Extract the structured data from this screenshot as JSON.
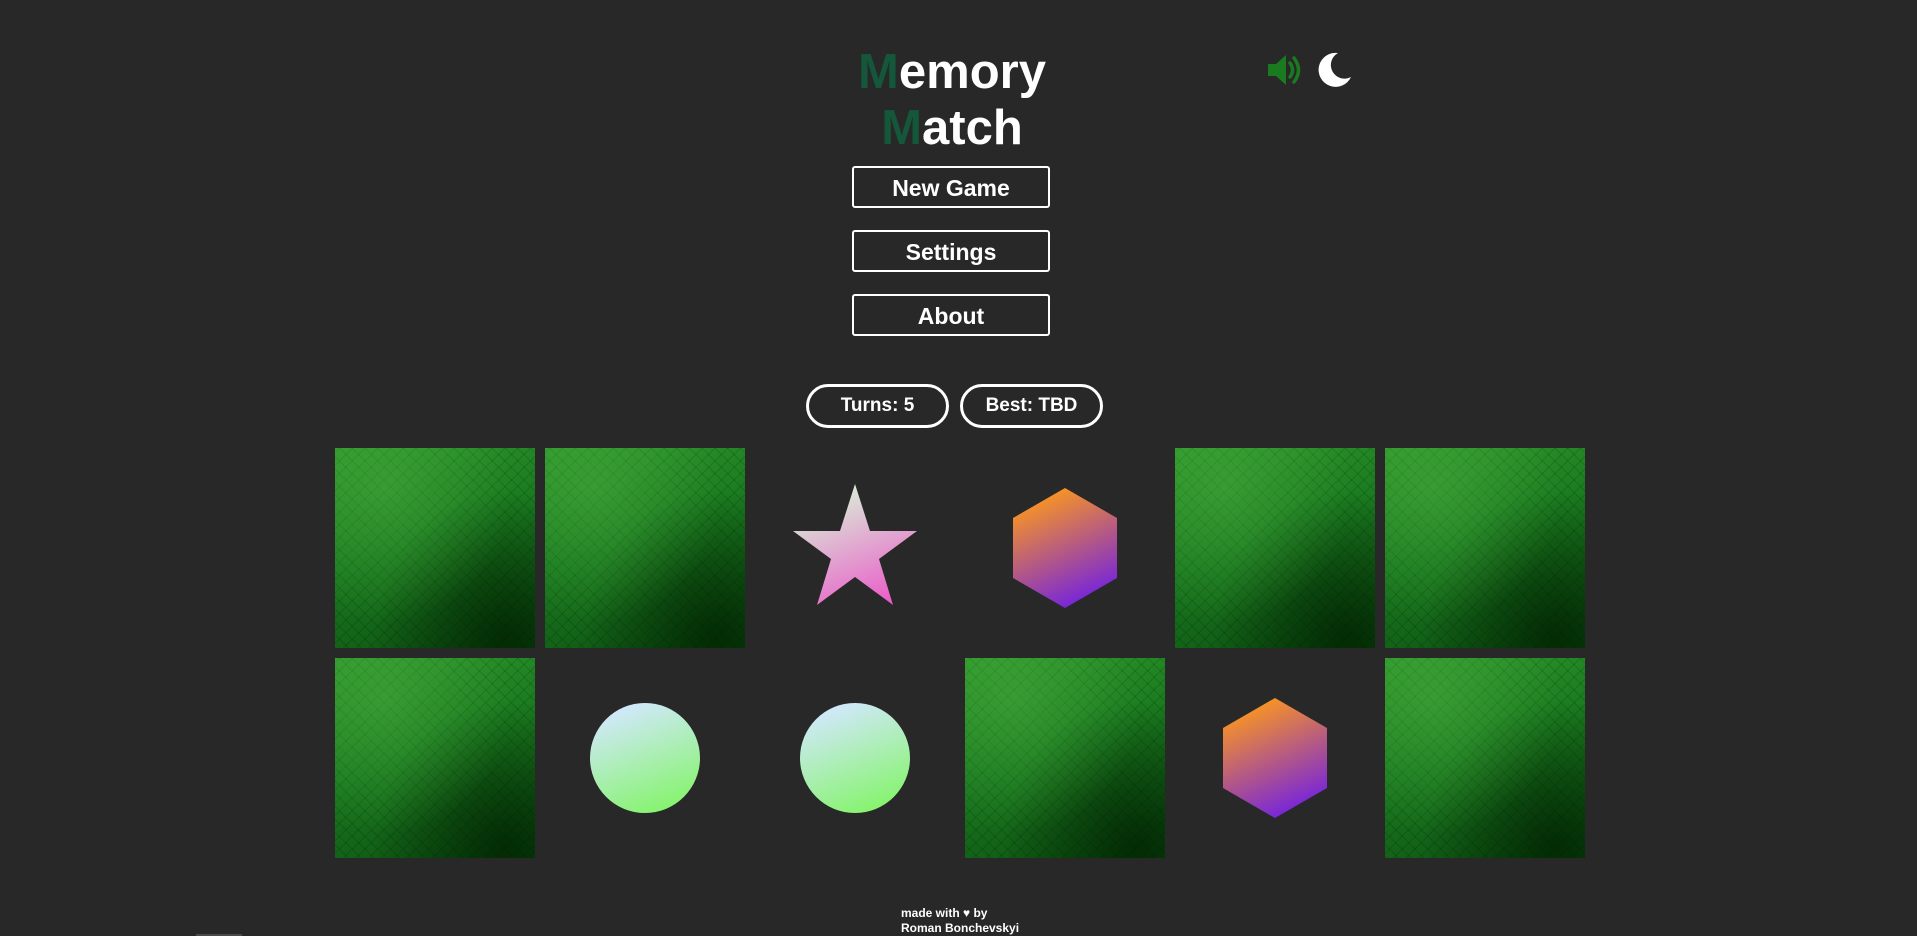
{
  "title": {
    "line1_first": "M",
    "line1_rest": "emory",
    "line2_first": "M",
    "line2_rest": "atch"
  },
  "controls": {
    "sound_icon": "speaker-volume-icon",
    "theme_icon": "crescent-moon-icon",
    "sound_color": "#1a7a1f",
    "theme_color": "#ffffff"
  },
  "menu": {
    "new_game_label": "New Game",
    "settings_label": "Settings",
    "about_label": "About"
  },
  "stats": {
    "turns_label": "Turns:",
    "turns_value": "5",
    "best_label": "Best:",
    "best_value": "TBD"
  },
  "board": {
    "rows": [
      [
        {
          "state": "hidden"
        },
        {
          "state": "hidden"
        },
        {
          "state": "revealed",
          "shape": "star",
          "colors": [
            "#d8f5d8",
            "#e95fc9"
          ]
        },
        {
          "state": "revealed",
          "shape": "hexagon",
          "colors": [
            "#ff9a1a",
            "#6f1ee6"
          ]
        },
        {
          "state": "hidden"
        },
        {
          "state": "hidden"
        }
      ],
      [
        {
          "state": "hidden"
        },
        {
          "state": "revealed",
          "shape": "circle",
          "colors": [
            "#d3e8ff",
            "#84f46a"
          ]
        },
        {
          "state": "revealed",
          "shape": "circle",
          "colors": [
            "#d3e8ff",
            "#84f46a"
          ]
        },
        {
          "state": "hidden"
        },
        {
          "state": "revealed",
          "shape": "hexagon",
          "colors": [
            "#ff9a1a",
            "#6f1ee6"
          ]
        },
        {
          "state": "hidden"
        }
      ]
    ],
    "back_color": "#1d7a22"
  },
  "footer": {
    "line1": "made with ♥ by",
    "line2": "Roman Bonchevskyi"
  },
  "colors": {
    "background": "#282828",
    "title_accent": "#14573a",
    "text": "#ffffff"
  }
}
